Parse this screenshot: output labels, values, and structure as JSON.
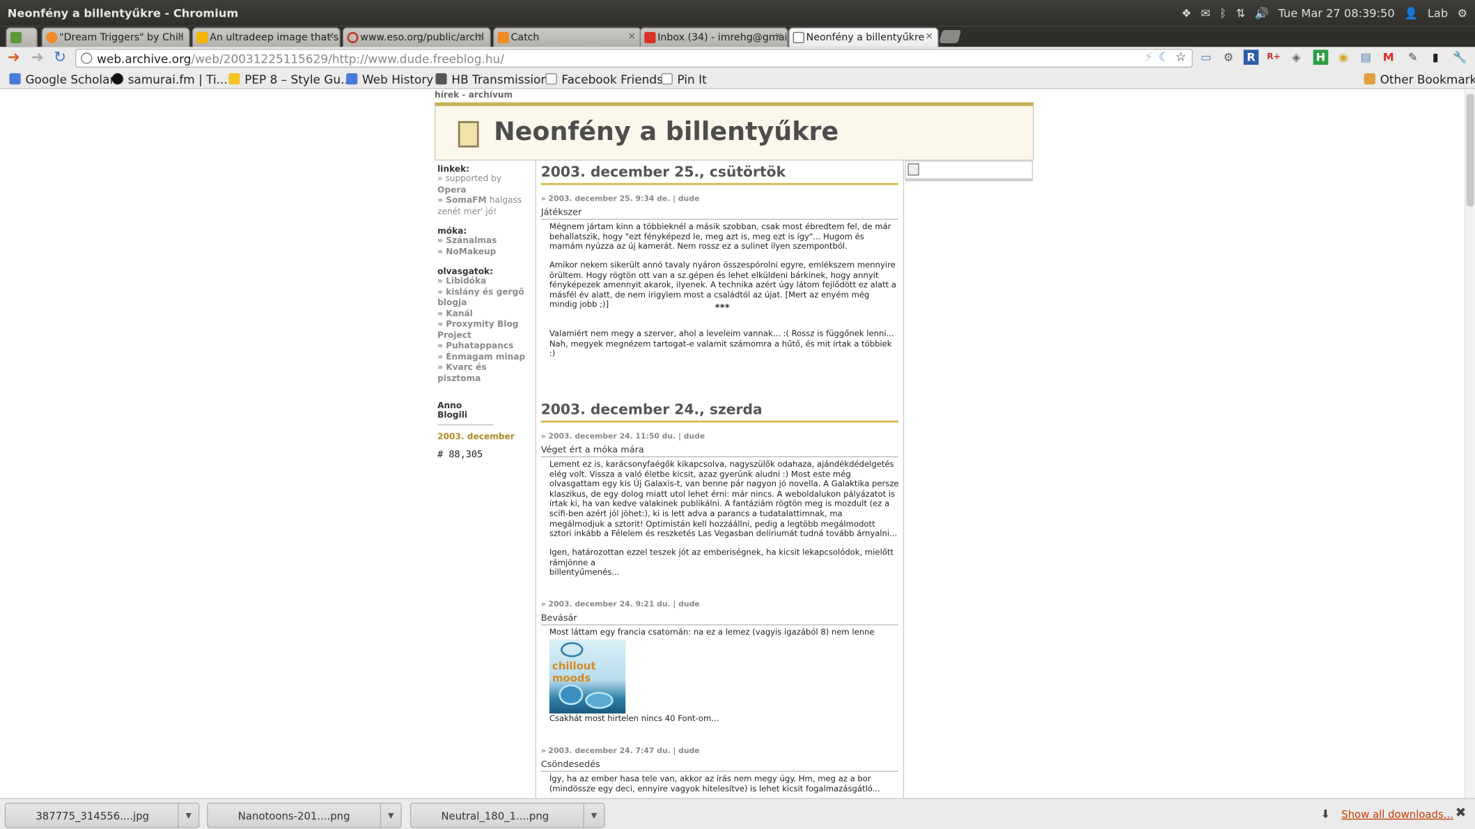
{
  "window": {
    "title": "Neonfény a billentyűkre - Chromium"
  },
  "tray": {
    "clock": "Tue Mar 27 08:39:50",
    "user": "Lab",
    "dropbox_icon": "dropbox-icon",
    "mail_icon": "mail-icon",
    "bluetooth_icon": "bluetooth-icon",
    "network_icon": "network-icon",
    "volume_icon": "volume-icon",
    "gear_icon": "gear-icon"
  },
  "tabs": [
    {
      "label": "",
      "active": false
    },
    {
      "label": "\"Dream Triggers\" by Chill",
      "active": false
    },
    {
      "label": "An ultradeep image that's",
      "active": false
    },
    {
      "label": "www.eso.org/public/archi",
      "active": false
    },
    {
      "label": "Catch",
      "active": false
    },
    {
      "label": "Inbox (34) - imrehg@gmail",
      "active": false
    },
    {
      "label": "Neonfény a billentyűkre",
      "active": true
    }
  ],
  "toolbar": {
    "url_host": "web.archive.org",
    "url_path": "/web/20031225115629/http://www.dude.freeblog.hu/"
  },
  "bookmarks": [
    {
      "label": "Google Scholar"
    },
    {
      "label": "samurai.fm | Ti..."
    },
    {
      "label": "PEP 8 – Style Gu..."
    },
    {
      "label": "Web History"
    },
    {
      "label": "HB Transmission"
    },
    {
      "label": "Facebook Friends"
    },
    {
      "label": "Pin It"
    }
  ],
  "other_bookmarks": "Other Bookmarks",
  "blog": {
    "breadcrumb": "hírek - archívum",
    "title": "Neonfény a billentyűkre",
    "sidebar": {
      "links_heading": "linkek:",
      "links_1": "» supported by",
      "links_1b": "Opera",
      "links_2": "» SomaFM",
      "links_2b": "halgass",
      "links_2c": "zenét mer' jó!",
      "fun_heading": "móka:",
      "fun_1": "» Szánalmas",
      "fun_2": "» NoMakeup",
      "readers_heading": "olvasgatok:",
      "readers_1": "» Libidóka",
      "readers_2": "» kislány és gergő",
      "readers_2b": "blogja",
      "readers_3": "» Kanál",
      "readers_4": "» Proxymity Blog",
      "readers_4b": "Project",
      "readers_5": "» Puhatappancs",
      "readers_6": "» Énmagam minap",
      "readers_7": "» Kvarc és pisztoma",
      "archive_heading": "Anno Blogili",
      "archive_month": "2003. december",
      "counter_prefix": "#",
      "counter": "88,305"
    },
    "day1": {
      "heading": "2003. december 25., csütörtök",
      "meta": "» 2003. december 25. 9:34 de. | dude",
      "entry_title": "Játékszer",
      "p1": "Mégnem jártam kinn a többieknél a másik szobban, csak most ébredtem fel, de már behallatszik, hogy \"ezt fényképezd le, meg azt is, meg ezt is így\"... Hugom és mamám nyúzza az új kamerát. Nem rossz ez a sulinet ilyen szempontból.",
      "p2": "Amikor nekem sikerült annó tavaly nyáron összespórolni egyre, emlékszem mennyire örültem. Hogy rögtön ott van a sz.gépen és lehet elküldeni bárkinek, hogy annyit fényképezek amennyit akarok, ilyenek. A technika azért úgy látom fejlődött ez alatt a másfél év alatt, de nem irigylem most a családtól az újat. [Mert az enyém még mindig jobb ;)]",
      "stars": "***",
      "p3": "Valamiért nem megy a szerver, ahol a leveleim vannak... :( Rossz is függőnek lenni... Nah, megyek megnézem tartogat-e valamit számomra a hűtő, és mit írtak a többiek :)"
    },
    "day2": {
      "heading": "2003. december 24., szerda",
      "e1_meta": "» 2003. december 24. 11:50 du. | dude",
      "e1_title": "Véget ért a móka mára",
      "e1_p1": "Lement ez is, karácsonyfaégők kikapcsolva, nagyszülők odahaza, ajándékdédelgetés elég volt. Vissza a való életbe kicsit, azaz gyerünk aludni :) Most este még olvasgattam egy kis Új Galaxis-t, van benne pár nagyon jó novella. A Galaktika persze klaszikus, de egy dolog miatt utol lehet érni: már nincs. A weboldalukon pályázatot is írtak ki, ha van kedve valakinek publikálni. A fantáziám rögtön meg is mozdult (ez a scifi-ben azért jól jöhet:), ki is lett adva a parancs a tudatalattimnak, ma megálmodjuk a sztorit! Optimistán kell hozzáállni, pedig a legtöbb megálmodott sztori inkább a Félelem és reszketés Las Vegasban delíriumát tudná tovább árnyalni...",
      "e1_p2a": "Igen, határozottan ezzel teszek jót az emberiségnek, ha kicsit lekapcsolódok, mielőtt rámjönne a",
      "e1_p2b": "billentyűmenés...",
      "e2_meta": "» 2003. december 24. 9:21 du. | dude",
      "e2_title": "Bevásár",
      "e2_p1": "Most láttam egy francia csatornán: na ez a lemez (vagyis igazából 8) nem lenne rossz...",
      "album_text": "chillout moods",
      "e2_p2": "Csakhát most hirtelen nincs 40 Font-om...",
      "e3_meta": "» 2003. december 24. 7:47 du. | dude",
      "e3_title": "Csöndesedés",
      "e3_p1": "Így, ha az ember hasa tele van, akkor az írás nem megy úgy. Hm, meg az a bor (mindössze egy deci, ennyire vagyok hitelesítve) is lehet kicsit fogalmazásgátló..."
    }
  },
  "downloads": {
    "items": [
      {
        "name": "387775_314556....jpg"
      },
      {
        "name": "Nanotoons-201....png"
      },
      {
        "name": "Neutral_180_1....png"
      }
    ],
    "show_all": "Show all downloads..."
  }
}
